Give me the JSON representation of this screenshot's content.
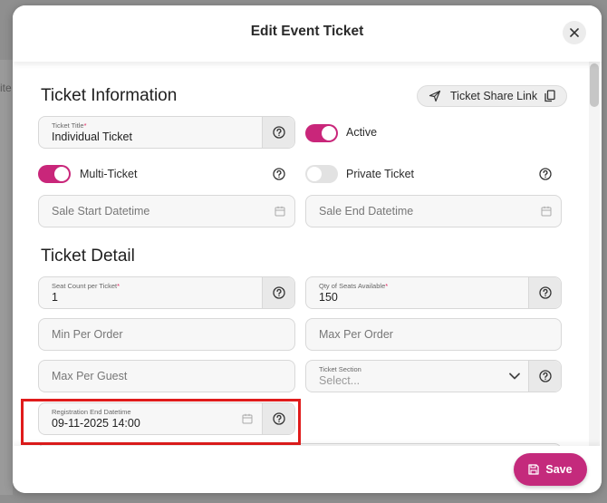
{
  "backdrop": {
    "partial_text": "ite"
  },
  "modal": {
    "title": "Edit Event Ticket",
    "close_icon": "close-icon"
  },
  "ticket_information": {
    "heading": "Ticket Information",
    "share_link_label": "Ticket Share Link",
    "ticket_title": {
      "label": "Ticket Title",
      "required_mark": "*",
      "value": "Individual Ticket"
    },
    "active": {
      "label": "Active",
      "checked": true
    },
    "multi_ticket": {
      "label": "Multi-Ticket",
      "checked": true
    },
    "private_ticket": {
      "label": "Private Ticket",
      "checked": false
    },
    "sale_start": {
      "placeholder": "Sale Start Datetime"
    },
    "sale_end": {
      "placeholder": "Sale End Datetime"
    }
  },
  "ticket_detail": {
    "heading": "Ticket Detail",
    "seat_count": {
      "label": "Seat Count per Ticket",
      "required_mark": "*",
      "value": "1"
    },
    "qty_seats": {
      "label": "Qty of Seats Available",
      "required_mark": "*",
      "value": "150"
    },
    "min_per_order": {
      "placeholder": "Min Per Order"
    },
    "max_per_order": {
      "placeholder": "Max Per Order"
    },
    "max_per_guest": {
      "placeholder": "Max Per Guest"
    },
    "ticket_section": {
      "label": "Ticket Section",
      "placeholder": "Select..."
    },
    "registration_end": {
      "label": "Registration End Datetime",
      "value": "09-11-2025 14:00"
    }
  },
  "footer": {
    "save_label": "Save"
  },
  "colors": {
    "accent": "#c42a7c",
    "highlight": "#e01b1b"
  }
}
